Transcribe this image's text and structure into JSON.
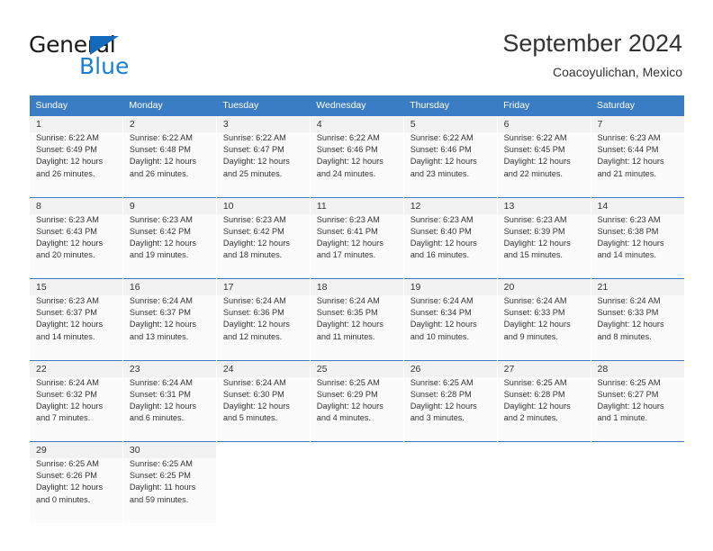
{
  "brand": {
    "name_top": "General",
    "name_bottom": "Blue",
    "triangle_color": "#1569bd",
    "blue_color": "#1a7fd4"
  },
  "header": {
    "title": "September 2024",
    "subtitle": "Coacoyulichan, Mexico"
  },
  "theme": {
    "header_bg": "#3b7dc4",
    "daynum_bg": "#f2f2f2",
    "cell_bg": "#fbfbfb",
    "text": "#333333"
  },
  "weekday_headers": [
    "Sunday",
    "Monday",
    "Tuesday",
    "Wednesday",
    "Thursday",
    "Friday",
    "Saturday"
  ],
  "weeks": [
    {
      "days": [
        {
          "date": "1",
          "sunrise": "Sunrise: 6:22 AM",
          "sunset": "Sunset: 6:49 PM",
          "daylight": "Daylight: 12 hours and 26 minutes."
        },
        {
          "date": "2",
          "sunrise": "Sunrise: 6:22 AM",
          "sunset": "Sunset: 6:48 PM",
          "daylight": "Daylight: 12 hours and 26 minutes."
        },
        {
          "date": "3",
          "sunrise": "Sunrise: 6:22 AM",
          "sunset": "Sunset: 6:47 PM",
          "daylight": "Daylight: 12 hours and 25 minutes."
        },
        {
          "date": "4",
          "sunrise": "Sunrise: 6:22 AM",
          "sunset": "Sunset: 6:46 PM",
          "daylight": "Daylight: 12 hours and 24 minutes."
        },
        {
          "date": "5",
          "sunrise": "Sunrise: 6:22 AM",
          "sunset": "Sunset: 6:46 PM",
          "daylight": "Daylight: 12 hours and 23 minutes."
        },
        {
          "date": "6",
          "sunrise": "Sunrise: 6:22 AM",
          "sunset": "Sunset: 6:45 PM",
          "daylight": "Daylight: 12 hours and 22 minutes."
        },
        {
          "date": "7",
          "sunrise": "Sunrise: 6:23 AM",
          "sunset": "Sunset: 6:44 PM",
          "daylight": "Daylight: 12 hours and 21 minutes."
        }
      ]
    },
    {
      "days": [
        {
          "date": "8",
          "sunrise": "Sunrise: 6:23 AM",
          "sunset": "Sunset: 6:43 PM",
          "daylight": "Daylight: 12 hours and 20 minutes."
        },
        {
          "date": "9",
          "sunrise": "Sunrise: 6:23 AM",
          "sunset": "Sunset: 6:42 PM",
          "daylight": "Daylight: 12 hours and 19 minutes."
        },
        {
          "date": "10",
          "sunrise": "Sunrise: 6:23 AM",
          "sunset": "Sunset: 6:42 PM",
          "daylight": "Daylight: 12 hours and 18 minutes."
        },
        {
          "date": "11",
          "sunrise": "Sunrise: 6:23 AM",
          "sunset": "Sunset: 6:41 PM",
          "daylight": "Daylight: 12 hours and 17 minutes."
        },
        {
          "date": "12",
          "sunrise": "Sunrise: 6:23 AM",
          "sunset": "Sunset: 6:40 PM",
          "daylight": "Daylight: 12 hours and 16 minutes."
        },
        {
          "date": "13",
          "sunrise": "Sunrise: 6:23 AM",
          "sunset": "Sunset: 6:39 PM",
          "daylight": "Daylight: 12 hours and 15 minutes."
        },
        {
          "date": "14",
          "sunrise": "Sunrise: 6:23 AM",
          "sunset": "Sunset: 6:38 PM",
          "daylight": "Daylight: 12 hours and 14 minutes."
        }
      ]
    },
    {
      "days": [
        {
          "date": "15",
          "sunrise": "Sunrise: 6:23 AM",
          "sunset": "Sunset: 6:37 PM",
          "daylight": "Daylight: 12 hours and 14 minutes."
        },
        {
          "date": "16",
          "sunrise": "Sunrise: 6:24 AM",
          "sunset": "Sunset: 6:37 PM",
          "daylight": "Daylight: 12 hours and 13 minutes."
        },
        {
          "date": "17",
          "sunrise": "Sunrise: 6:24 AM",
          "sunset": "Sunset: 6:36 PM",
          "daylight": "Daylight: 12 hours and 12 minutes."
        },
        {
          "date": "18",
          "sunrise": "Sunrise: 6:24 AM",
          "sunset": "Sunset: 6:35 PM",
          "daylight": "Daylight: 12 hours and 11 minutes."
        },
        {
          "date": "19",
          "sunrise": "Sunrise: 6:24 AM",
          "sunset": "Sunset: 6:34 PM",
          "daylight": "Daylight: 12 hours and 10 minutes."
        },
        {
          "date": "20",
          "sunrise": "Sunrise: 6:24 AM",
          "sunset": "Sunset: 6:33 PM",
          "daylight": "Daylight: 12 hours and 9 minutes."
        },
        {
          "date": "21",
          "sunrise": "Sunrise: 6:24 AM",
          "sunset": "Sunset: 6:33 PM",
          "daylight": "Daylight: 12 hours and 8 minutes."
        }
      ]
    },
    {
      "days": [
        {
          "date": "22",
          "sunrise": "Sunrise: 6:24 AM",
          "sunset": "Sunset: 6:32 PM",
          "daylight": "Daylight: 12 hours and 7 minutes."
        },
        {
          "date": "23",
          "sunrise": "Sunrise: 6:24 AM",
          "sunset": "Sunset: 6:31 PM",
          "daylight": "Daylight: 12 hours and 6 minutes."
        },
        {
          "date": "24",
          "sunrise": "Sunrise: 6:24 AM",
          "sunset": "Sunset: 6:30 PM",
          "daylight": "Daylight: 12 hours and 5 minutes."
        },
        {
          "date": "25",
          "sunrise": "Sunrise: 6:25 AM",
          "sunset": "Sunset: 6:29 PM",
          "daylight": "Daylight: 12 hours and 4 minutes."
        },
        {
          "date": "26",
          "sunrise": "Sunrise: 6:25 AM",
          "sunset": "Sunset: 6:28 PM",
          "daylight": "Daylight: 12 hours and 3 minutes."
        },
        {
          "date": "27",
          "sunrise": "Sunrise: 6:25 AM",
          "sunset": "Sunset: 6:28 PM",
          "daylight": "Daylight: 12 hours and 2 minutes."
        },
        {
          "date": "28",
          "sunrise": "Sunrise: 6:25 AM",
          "sunset": "Sunset: 6:27 PM",
          "daylight": "Daylight: 12 hours and 1 minute."
        }
      ]
    },
    {
      "days": [
        {
          "date": "29",
          "sunrise": "Sunrise: 6:25 AM",
          "sunset": "Sunset: 6:26 PM",
          "daylight": "Daylight: 12 hours and 0 minutes."
        },
        {
          "date": "30",
          "sunrise": "Sunrise: 6:25 AM",
          "sunset": "Sunset: 6:25 PM",
          "daylight": "Daylight: 11 hours and 59 minutes."
        },
        {
          "date": "",
          "sunrise": "",
          "sunset": "",
          "daylight": ""
        },
        {
          "date": "",
          "sunrise": "",
          "sunset": "",
          "daylight": ""
        },
        {
          "date": "",
          "sunrise": "",
          "sunset": "",
          "daylight": ""
        },
        {
          "date": "",
          "sunrise": "",
          "sunset": "",
          "daylight": ""
        },
        {
          "date": "",
          "sunrise": "",
          "sunset": "",
          "daylight": ""
        }
      ]
    }
  ]
}
